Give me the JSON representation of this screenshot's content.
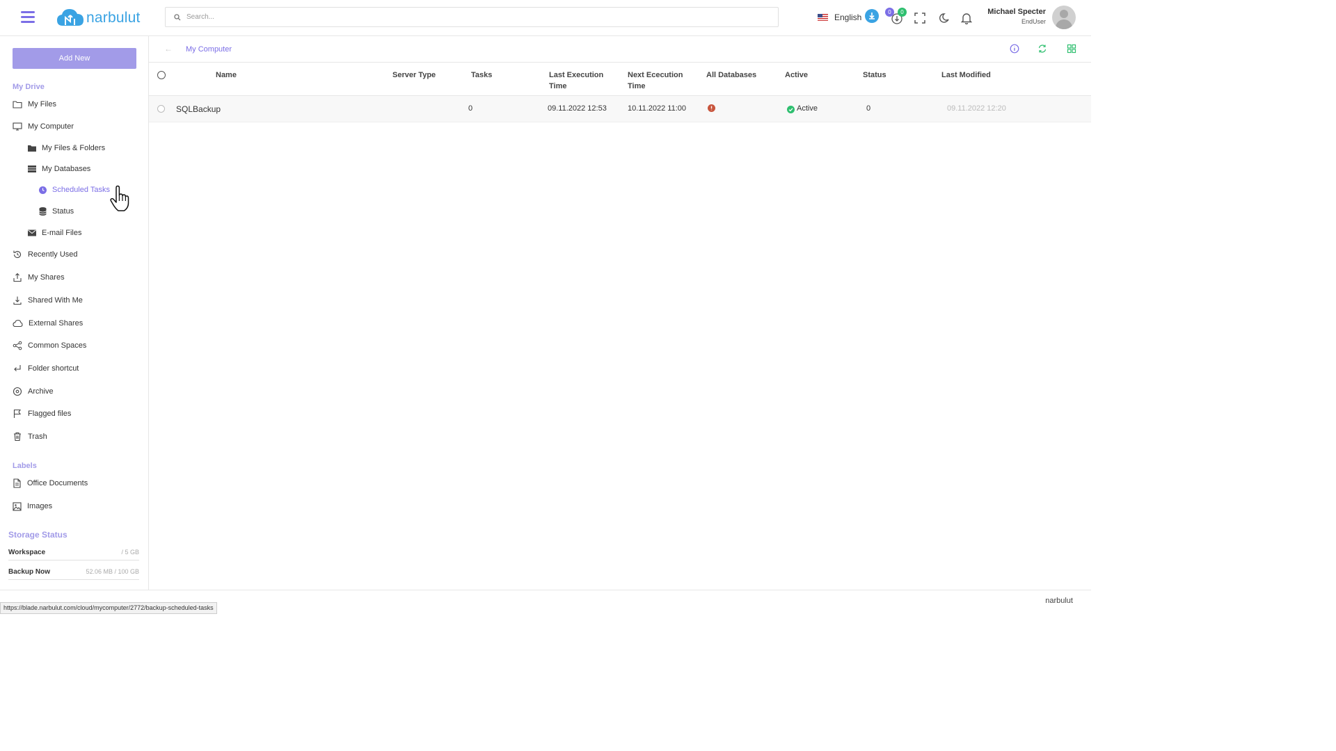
{
  "header": {
    "logo_text": "narbulut",
    "search_placeholder": "Search...",
    "language": "English",
    "badge_blue": "0",
    "badge_green": "0",
    "user_name": "Michael Specter",
    "user_role": "EndUser"
  },
  "sidebar": {
    "add_new": "Add New",
    "my_drive_label": "My Drive",
    "items": {
      "my_files": "My Files",
      "my_computer": "My Computer",
      "my_files_folders": "My Files & Folders",
      "my_databases": "My Databases",
      "scheduled_tasks": "Scheduled Tasks",
      "status": "Status",
      "email_files": "E-mail Files",
      "recently_used": "Recently Used",
      "my_shares": "My Shares",
      "shared_with_me": "Shared With Me",
      "external_shares": "External Shares",
      "common_spaces": "Common Spaces",
      "folder_shortcut": "Folder shortcut",
      "archive": "Archive",
      "flagged_files": "Flagged files",
      "trash": "Trash"
    },
    "labels_label": "Labels",
    "labels": {
      "office_documents": "Office Documents",
      "images": "Images"
    },
    "storage": {
      "title": "Storage Status",
      "workspace_label": "Workspace",
      "workspace_value": "/ 5 GB",
      "backup_label": "Backup Now",
      "backup_value": "52.06 MB / 100 GB"
    }
  },
  "breadcrumb": {
    "current": "My Computer"
  },
  "table": {
    "columns": {
      "name": "Name",
      "server_type": "Server Type",
      "tasks": "Tasks",
      "last_execution_1": "Last Execution",
      "last_execution_2": "Time",
      "next_execution_1": "Next Ececution",
      "next_execution_2": "Time",
      "all_databases": "All Databases",
      "active": "Active",
      "status": "Status",
      "last_modified": "Last Modified"
    },
    "rows": [
      {
        "name": "SQLBackup",
        "server_type": "",
        "tasks": "0",
        "last_execution": "09.11.2022 12:53",
        "next_execution": "10.11.2022 11:00",
        "all_databases_icon": "warning-icon",
        "active": "Active",
        "status": "0",
        "last_modified": "09.11.2022 12:20"
      }
    ]
  },
  "footer": {
    "brand": "narbulut",
    "status_url": "https://blade.narbulut.com/cloud/mycomputer/2772/backup-scheduled-tasks"
  },
  "colors": {
    "accent": "#7b6ee6",
    "accent_light": "#a29be8",
    "brand_blue": "#3aa3e3",
    "success": "#2ebf6f",
    "warning": "#c8553d"
  }
}
